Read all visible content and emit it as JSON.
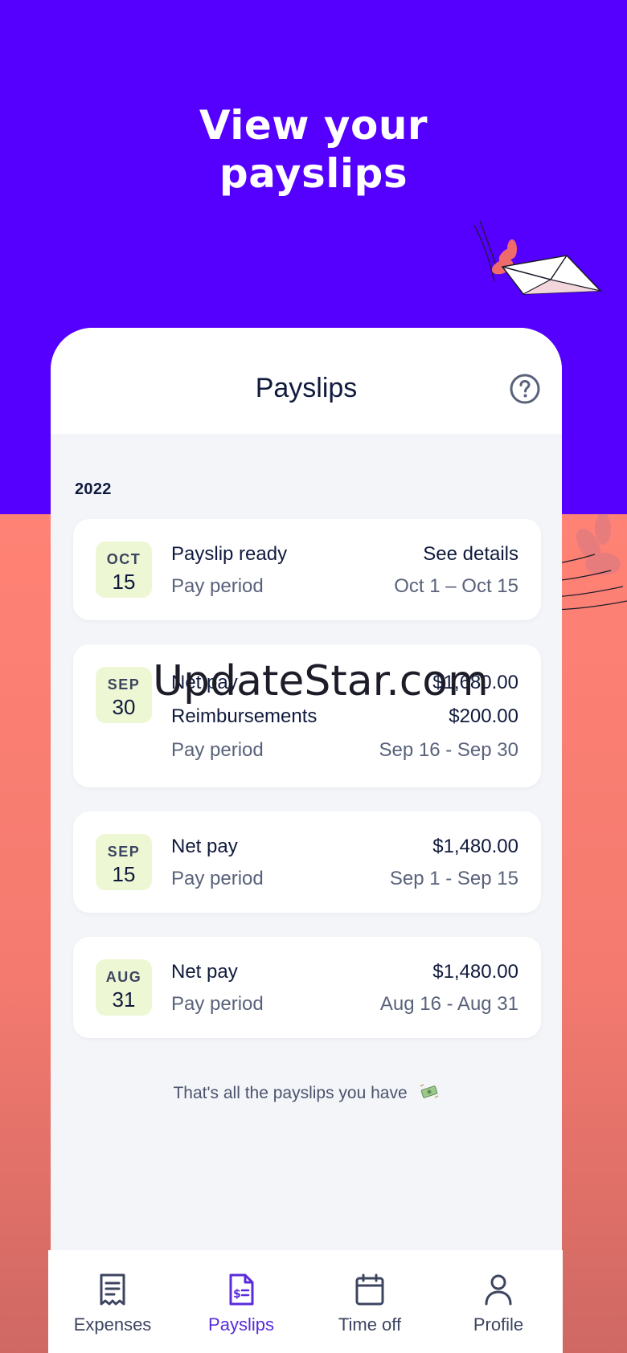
{
  "hero": {
    "line1": "View your",
    "line2": "payslips"
  },
  "screen": {
    "title": "Payslips",
    "year": "2022",
    "end_note": "That's all the payslips you have"
  },
  "payslips": [
    {
      "month": "OCT",
      "day": "15",
      "rows": [
        {
          "label": "Payslip ready",
          "value": "See details"
        },
        {
          "label": "Pay period",
          "value": "Oct 1 – Oct 15"
        }
      ]
    },
    {
      "month": "SEP",
      "day": "30",
      "rows": [
        {
          "label": "Net pay",
          "value": "$1,680.00"
        },
        {
          "label": "Reimbursements",
          "value": "$200.00"
        },
        {
          "label": "Pay period",
          "value": "Sep 16 - Sep 30"
        }
      ]
    },
    {
      "month": "SEP",
      "day": "15",
      "rows": [
        {
          "label": "Net pay",
          "value": "$1,480.00"
        },
        {
          "label": "Pay period",
          "value": "Sep 1 - Sep 15"
        }
      ]
    },
    {
      "month": "AUG",
      "day": "31",
      "rows": [
        {
          "label": "Net pay",
          "value": "$1,480.00"
        },
        {
          "label": "Pay period",
          "value": "Aug 16 - Aug 31"
        }
      ]
    }
  ],
  "nav": {
    "expenses": "Expenses",
    "payslips": "Payslips",
    "time_off": "Time off",
    "profile": "Profile",
    "active": "payslips"
  },
  "watermark": "UpdateStar.com",
  "colors": {
    "brand_purple": "#5500ff",
    "coral": "#ff8275",
    "active_nav": "#5a2bdc",
    "date_badge": "#eef7d3",
    "text_dark": "#101a3d"
  },
  "icons": {
    "help": "help-circle-icon",
    "expenses": "receipt-icon",
    "payslips": "payslip-document-icon",
    "time_off": "calendar-icon",
    "profile": "person-icon",
    "end_note": "flying-money-icon"
  }
}
